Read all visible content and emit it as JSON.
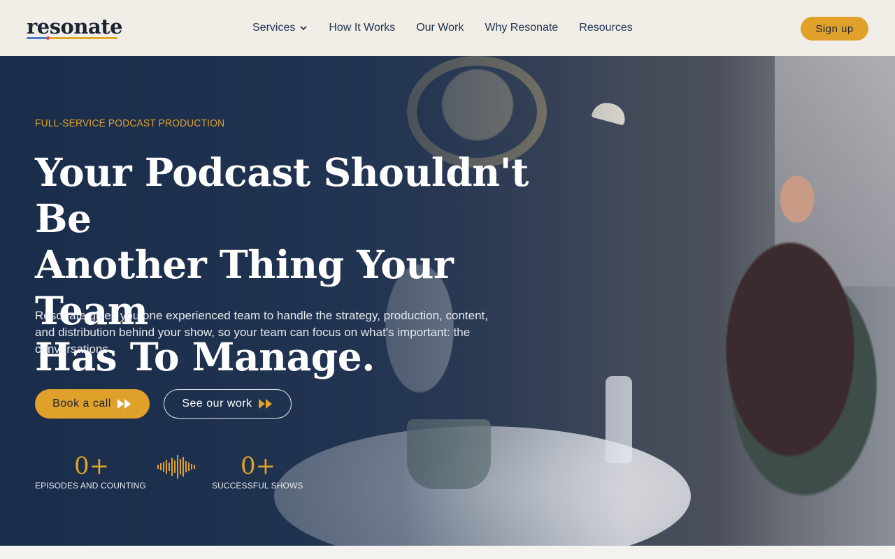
{
  "brand": {
    "name": "resonate",
    "accent": "#e0a12a",
    "navy": "#1f3350"
  },
  "nav": {
    "items": [
      {
        "label": "Services",
        "has_dropdown": true
      },
      {
        "label": "How It Works"
      },
      {
        "label": "Our Work"
      },
      {
        "label": "Why Resonate"
      },
      {
        "label": "Resources"
      }
    ],
    "signup_label": "Sign up"
  },
  "hero": {
    "eyebrow": "FULL-SERVICE PODCAST PRODUCTION",
    "headline_lines": [
      "Your Podcast Shouldn't Be",
      "Another Thing Your Team",
      "Has To Manage."
    ],
    "subtext": "Resonate gives you one experienced team to handle the strategy, production, content, and distribution behind your show, so your team can focus on what's important: the conversations.",
    "primary_cta": "Book a call",
    "secondary_cta": "See our work",
    "stats": [
      {
        "value": "0+",
        "label": "EPISODES AND COUNTING"
      },
      {
        "value": "0+",
        "label": "SUCCESSFUL SHOWS"
      }
    ]
  },
  "icons": {
    "chevron": "chevron-down-icon",
    "fast_forward": "fast-forward-icon",
    "waveform": "audio-waveform-icon"
  }
}
